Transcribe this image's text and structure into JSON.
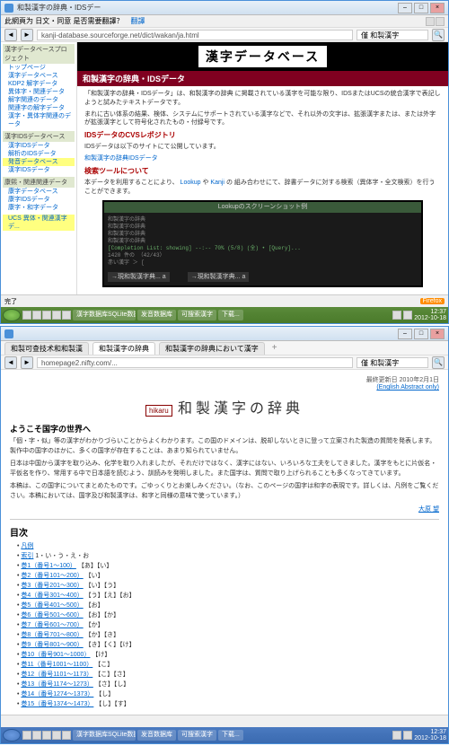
{
  "window1": {
    "title": "和製漢字の辞典・IDSデー",
    "toolbar": {
      "label": "此網頁为 日文・同意 是否需要翻譯？",
      "translate": "翻譯"
    },
    "url": "kanji-database.sourceforge.net/dict/wakan/ja.html",
    "search": "僅 和製漢字",
    "banner": "漢字データベース",
    "section_title": "和製漢字の辞典・IDSデータ",
    "para1": "「和製漢字の辞典・IDSデータ」は、和製漢字の辞典 に掲載されている漢字を可能な限り、IDSまたはUCSの統合漢字で表記しようと試みたテキストデータです。",
    "para2": "まれに古い体系の結果、検体、システムにサポートされている漢字などで、それ以外の文字は、拡張漢字または、または外字が拡張漢字として符号化されたもの・付録号です。",
    "h_cvs": "IDSデータのCVSレポジトリ",
    "cvs_text": "IDSデータは以下のサイトにて公開しています。",
    "cvs_link": "和製漢字の辞典IDSデータ",
    "h_search": "検索ツールについて",
    "search_text_1": "本データを利用することにより、",
    "search_link1": "Lookup",
    "search_text_2": "や",
    "search_link2": "Kanji",
    "search_text_3": "の 組み合わせにて、辞書データに対する検索（異体字・全文検索）を行うことができます。",
    "ss_caption": "Lookupのスクリーンショット例",
    "ss_lines": [
      "和製漢字の辞典",
      "和製漢字の辞典",
      "和製漢字の辞典",
      "和製漢字の辞典",
      "[Completion List: showing]  --:--  70%  (5/8) (全) • [Query]...",
      "1420 件の （42/43）",
      "赤い漢字 ＞ ["
    ],
    "ss_input1": "→現和製漢字典... a",
    "ss_input2": "→現和製漢字典... a",
    "sidebar": {
      "g1_title": "漢字データベースプロジェクト",
      "g1": [
        "トップページ",
        "漢字データベース",
        "KDP2 解字データ",
        "異体字・関連データ",
        "解字関連のデータ",
        "関連字の解字データ",
        "漢字・異体字関連のデータ"
      ],
      "g2_title": "漢字IDSデータベース",
      "g2": [
        "漢字IDSデータ",
        "解析のIDSデータ",
        "発音データベース",
        "漢字IDSデータ"
      ],
      "g3_title": "康熙・関連関連データ",
      "g3": [
        "康字データベース",
        "康字IDSデータ",
        "康字・和字データ"
      ],
      "g4": [
        "UCS 異体・関連漢字デ..."
      ]
    },
    "statusbar": {
      "left": "完了",
      "badge": "Firefox"
    },
    "taskbar": {
      "btns": [
        "漢字数据库SQLite数据",
        "发音数据库",
        "可搜索漢字",
        "下载..."
      ],
      "time": "12:37",
      "date": "2012-10-18"
    }
  },
  "window2": {
    "tabs": [
      "和製可查技术和和製漢",
      "和製漢字の辞典",
      "和製漢字の辞典において漢字"
    ],
    "url": "homepage2.nifty.com/...",
    "search": "僅 和製漢字",
    "header_date": "最終更新日 2010年2月1日",
    "header_sub": "(English Abstract only)",
    "logo": "hikaru",
    "title": "和製漢字の辞典",
    "subtitle": "ようこそ国字の世界へ",
    "para1": "「個・字・似」等の漢字がわかりづらいことからよくわかります。この国のドメインは、脱却しないときに登って立案された製造の質問を発表します。製作中の国字のほかに、多くの国字が存在することは、あまり知られていません。",
    "para2": "日本は中国から漢字を取り込み、化学を取り入れましたが、それだけではなく、漢字にはない、いろいろな工夫をしてきました。漢字をもとに片仮名・平仮名を作り、常用する中で日本語を読むよう、訓読みを発明しました。また国字は、質問で取り上げられることも多くなってきています。",
    "para3": "本稿は、この国字についてまとめたものです。ごゆっくりとお楽しみください。（なお、このページの国字は和字の表現です。詳しくは、凡例をご覧ください。本稿においては、国字及び和製漢字は、和字と同様の意味で使っています。）",
    "signature": "大原 望",
    "toc_title": "目次",
    "toc": [
      {
        "t": "凡例"
      },
      {
        "t": "索引",
        "sub": "1・い・う・え・お"
      },
      {
        "t": "巻1（番号1～100）",
        "sub": "【あ】【い】"
      },
      {
        "t": "巻2（番号101～200）",
        "sub": "【い】"
      },
      {
        "t": "巻3（番号201～300）",
        "sub": "【い】【う】"
      },
      {
        "t": "巻4（番号301～400）",
        "sub": "【う】【え】【お】"
      },
      {
        "t": "巻5（番号401～500）",
        "sub": "【お】"
      },
      {
        "t": "巻6（番号501～600）",
        "sub": "【お】【か】"
      },
      {
        "t": "巻7（番号601～700）",
        "sub": "【か】"
      },
      {
        "t": "巻8（番号701～800）",
        "sub": "【か】【き】"
      },
      {
        "t": "巻9（番号801～900）",
        "sub": "【き】【く】【け】"
      },
      {
        "t": "巻10（番号901～1000）",
        "sub": "【け】"
      },
      {
        "t": "巻11（番号1001～1100）",
        "sub": "【こ】"
      },
      {
        "t": "巻12（番号1101～1173）",
        "sub": "【こ】【さ】"
      },
      {
        "t": "巻13（番号1174～1273）",
        "sub": "【さ】【し】"
      },
      {
        "t": "巻14（番号1274～1373）",
        "sub": "【し】"
      },
      {
        "t": "巻15（番号1374～1473）",
        "sub": "【し】【す】"
      }
    ],
    "taskbar": {
      "btns": [
        "漢字数据库SQLite数据",
        "发音数据库",
        "可搜索漢字",
        "下载..."
      ],
      "time": "12:37",
      "date": "2012-10-18"
    }
  }
}
